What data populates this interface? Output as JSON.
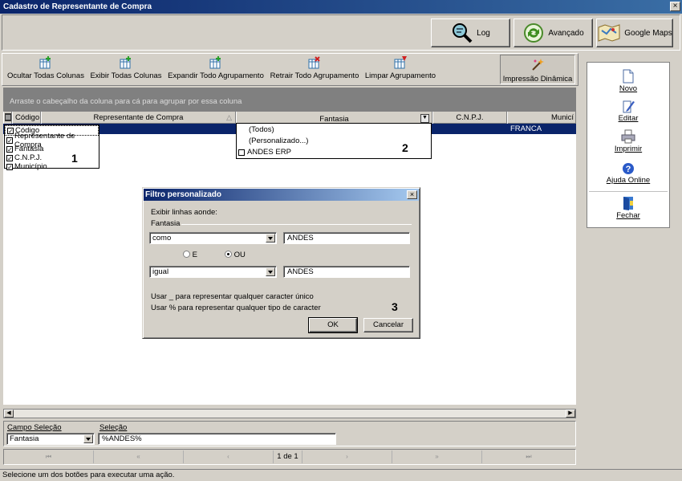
{
  "window": {
    "title": "Cadastro de Representante de Compra",
    "close": "×"
  },
  "topbar": {
    "log": "Log",
    "avancado": "Avançado",
    "maps": "Google Maps"
  },
  "toolbar": {
    "ocultar": "Ocultar Todas Colunas",
    "exibir": "Exibir Todas  Colunas",
    "expandir": "Expandir Todo Agrupamento",
    "retrair": "Retrair Todo Agrupamento",
    "limpar": "Limpar Agrupamento",
    "impressao": "Impressão Dinâmica"
  },
  "grid": {
    "group_hint": "Arraste o cabeçalho da coluna para cá para agrupar por essa coluna",
    "columns": [
      "Código",
      "Representante de Compra",
      "Fantasia",
      "C.N.P.J.",
      "Municí"
    ],
    "row": {
      "municipio": "FRANCA"
    }
  },
  "column_chooser": {
    "items": [
      "Código",
      "Representante de Compra",
      "Fantasia",
      "C.N.P.J.",
      "Município"
    ],
    "marker": "1"
  },
  "filter_dropdown": {
    "items": [
      "(Todos)",
      "(Personalizado...)",
      "ANDES ERP"
    ],
    "marker": "2"
  },
  "dialog": {
    "title": "Filtro personalizado",
    "intro": "Exibir linhas aonde:",
    "field": "Fantasia",
    "op1": "como",
    "val1": "ANDES",
    "radio_e": "E",
    "radio_ou": "OU",
    "op2": "igual",
    "val2": "ANDES",
    "hint1": "Usar _ para representar qualquer caracter único",
    "hint2": "Usar % para representar qualquer tipo de caracter",
    "ok": "OK",
    "cancel": "Cancelar",
    "marker": "3"
  },
  "right_panel": {
    "novo": "Novo",
    "editar": "Editar",
    "imprimir": "Imprimir",
    "ajuda": "Ajuda Online",
    "fechar": "Fechar"
  },
  "bottom": {
    "campo_label": "Campo Seleção",
    "campo_value": "Fantasia",
    "selecao_label": "Seleção",
    "selecao_value": "%ANDES%"
  },
  "navigator": {
    "first": "⏮",
    "prev_page": "«",
    "prev": "‹",
    "page": "1 de 1",
    "next": "›",
    "next_page": "»",
    "last": "⏭"
  },
  "status": "Selecione um dos botões para executar uma ação."
}
